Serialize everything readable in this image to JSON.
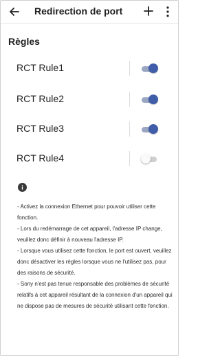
{
  "app_bar": {
    "title": "Redirection de port",
    "back_icon": "arrow-back-icon",
    "add_icon": "plus-icon",
    "menu_icon": "more-vert-icon"
  },
  "section": {
    "title": "Règles"
  },
  "rules": [
    {
      "label": "RCT Rule1",
      "enabled": true
    },
    {
      "label": "RCT Rule2",
      "enabled": true
    },
    {
      "label": "RCT Rule3",
      "enabled": true
    },
    {
      "label": "RCT Rule4",
      "enabled": false
    }
  ],
  "info": {
    "icon": "info-icon",
    "notes": [
      "- Activez la connexion Ethernet pour pouvoir utiliser cette fonction.",
      "- Lors du redémarrage de cet appareil, l'adresse IP change, veuillez donc définir à nouveau l'adresse IP.",
      "- Lorsque vous utilisez cette fonction, le port est ouvert, veuillez donc désactiver les règles lorsque vous ne l'utilisez pas, pour des raisons de sécurité.",
      "- Sony n'est pas tenue responsable des problèmes de sécurité relatifs à cet appareil résultant de la connexion d'un appareil qui ne dispose pas de mesures de sécurité utilisant cette fonction."
    ]
  },
  "colors": {
    "accent": "#3f5da8",
    "track_on": "#9aa6c2",
    "track_off": "#cfcfcf",
    "text": "#202020"
  }
}
